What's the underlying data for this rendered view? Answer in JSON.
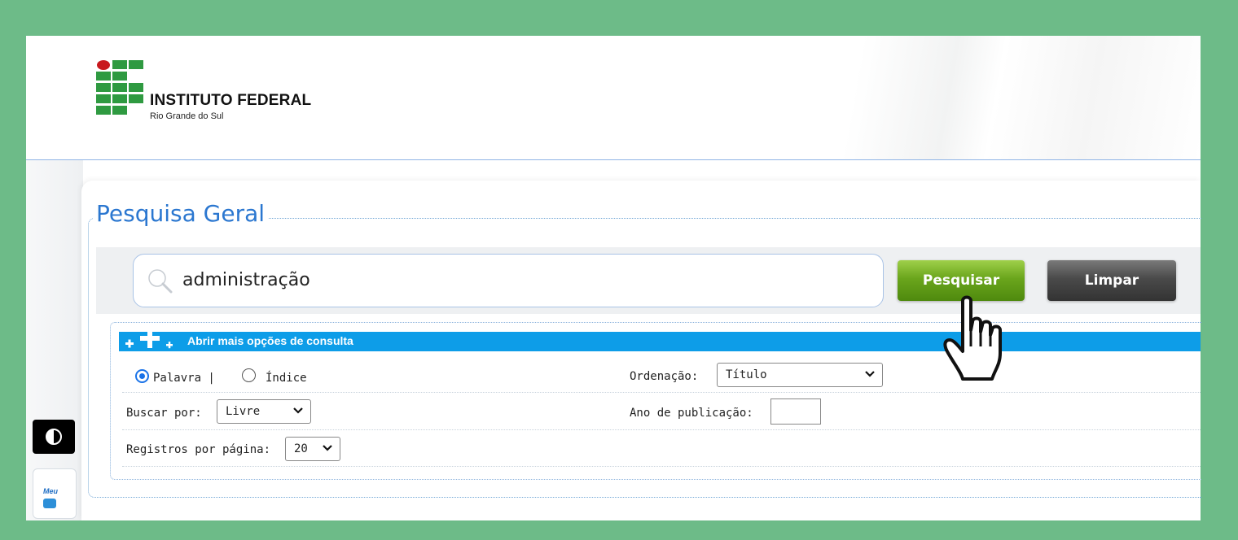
{
  "header": {
    "logo_title": "INSTITUTO FEDERAL",
    "logo_subtitle": "Rio Grande do Sul"
  },
  "colors": {
    "background": "#6dbb88",
    "accent_blue": "#2b77d0",
    "options_bar": "#0d9de8",
    "search_button": "#6aa51c",
    "clear_button": "#4a4a4a"
  },
  "sidebar": {
    "contrast_icon": "contrast-icon",
    "meu_label": "Meu"
  },
  "search": {
    "section_title": "Pesquisa Geral",
    "query": "administração",
    "search_button": "Pesquisar",
    "clear_button": "Limpar"
  },
  "options": {
    "toggle_label": "Abrir mais opções de consulta",
    "mode_palavra": "Palavra |",
    "mode_indice": "Índice",
    "ordering_label": "Ordenação:",
    "ordering_value": "Título",
    "search_by_label": "Buscar por:",
    "search_by_value": "Livre",
    "year_label": "Ano de publicação:",
    "per_page_label": "Registros por página:",
    "per_page_value": "20"
  }
}
